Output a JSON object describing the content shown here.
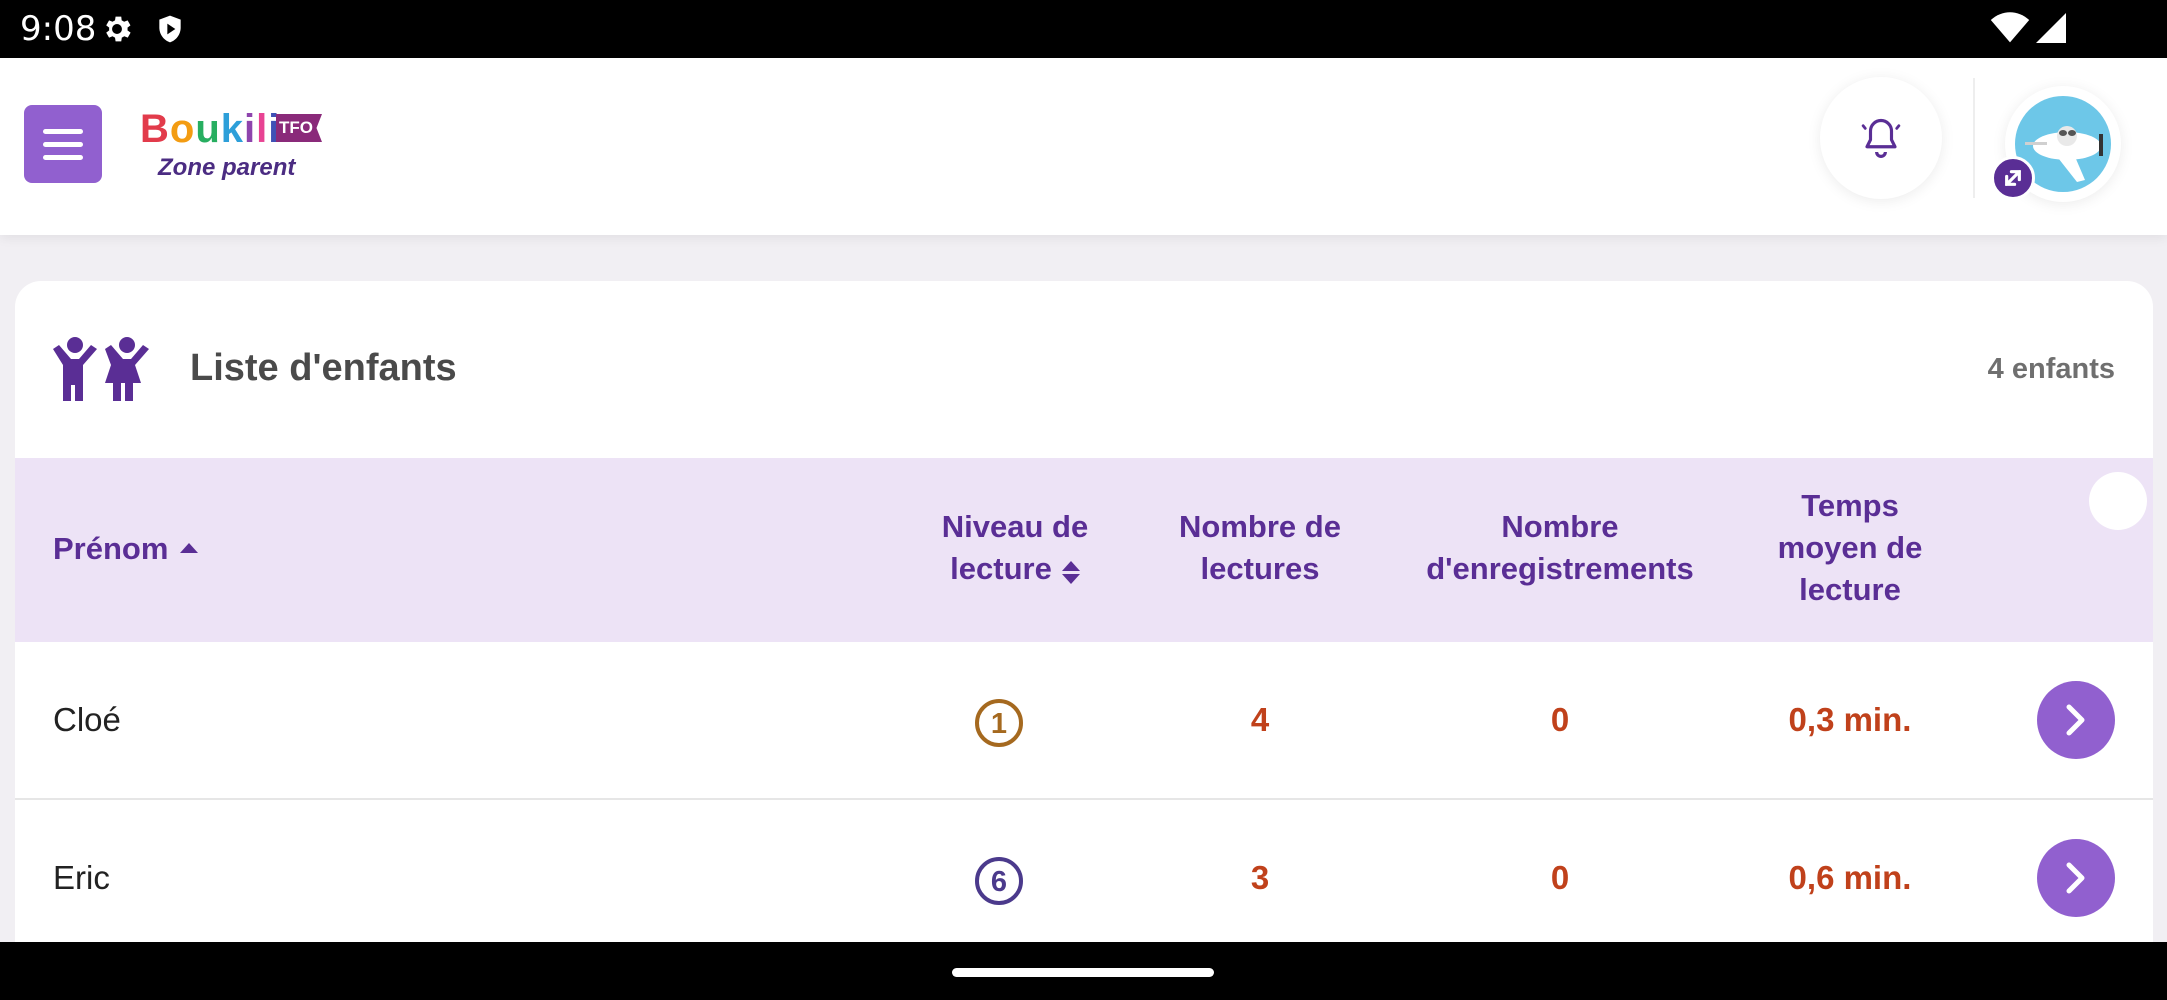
{
  "status_bar": {
    "time": "9:08",
    "icons": [
      "gear-icon",
      "shield-icon",
      "wifi-icon",
      "signal-icon"
    ]
  },
  "header": {
    "brand": "Boukili",
    "brand_badge": "TFO",
    "subtitle": "Zone parent",
    "icons": [
      "menu-icon",
      "bell-icon",
      "avatar-icon",
      "switch-icon"
    ]
  },
  "children_list": {
    "title": "Liste d'enfants",
    "count_label": "4 enfants",
    "columns": {
      "name": "Prénom",
      "level": "Niveau de lecture",
      "reads": "Nombre de lectures",
      "recordings": "Nombre d'enregistrements",
      "avg_time": "Temps moyen de lecture"
    },
    "rows": [
      {
        "name": "Cloé",
        "level": "1",
        "level_color": "#a5691f",
        "reads": "4",
        "recordings": "0",
        "avg_time": "0,3 min."
      },
      {
        "name": "Eric",
        "level": "6",
        "level_color": "#4b3a8c",
        "reads": "3",
        "recordings": "0",
        "avg_time": "0,6 min."
      }
    ]
  },
  "colors": {
    "accent": "#9160cf",
    "dark_purple": "#5a2e95",
    "table_header_bg": "#ede3f6",
    "value_orange": "#c0411b"
  }
}
